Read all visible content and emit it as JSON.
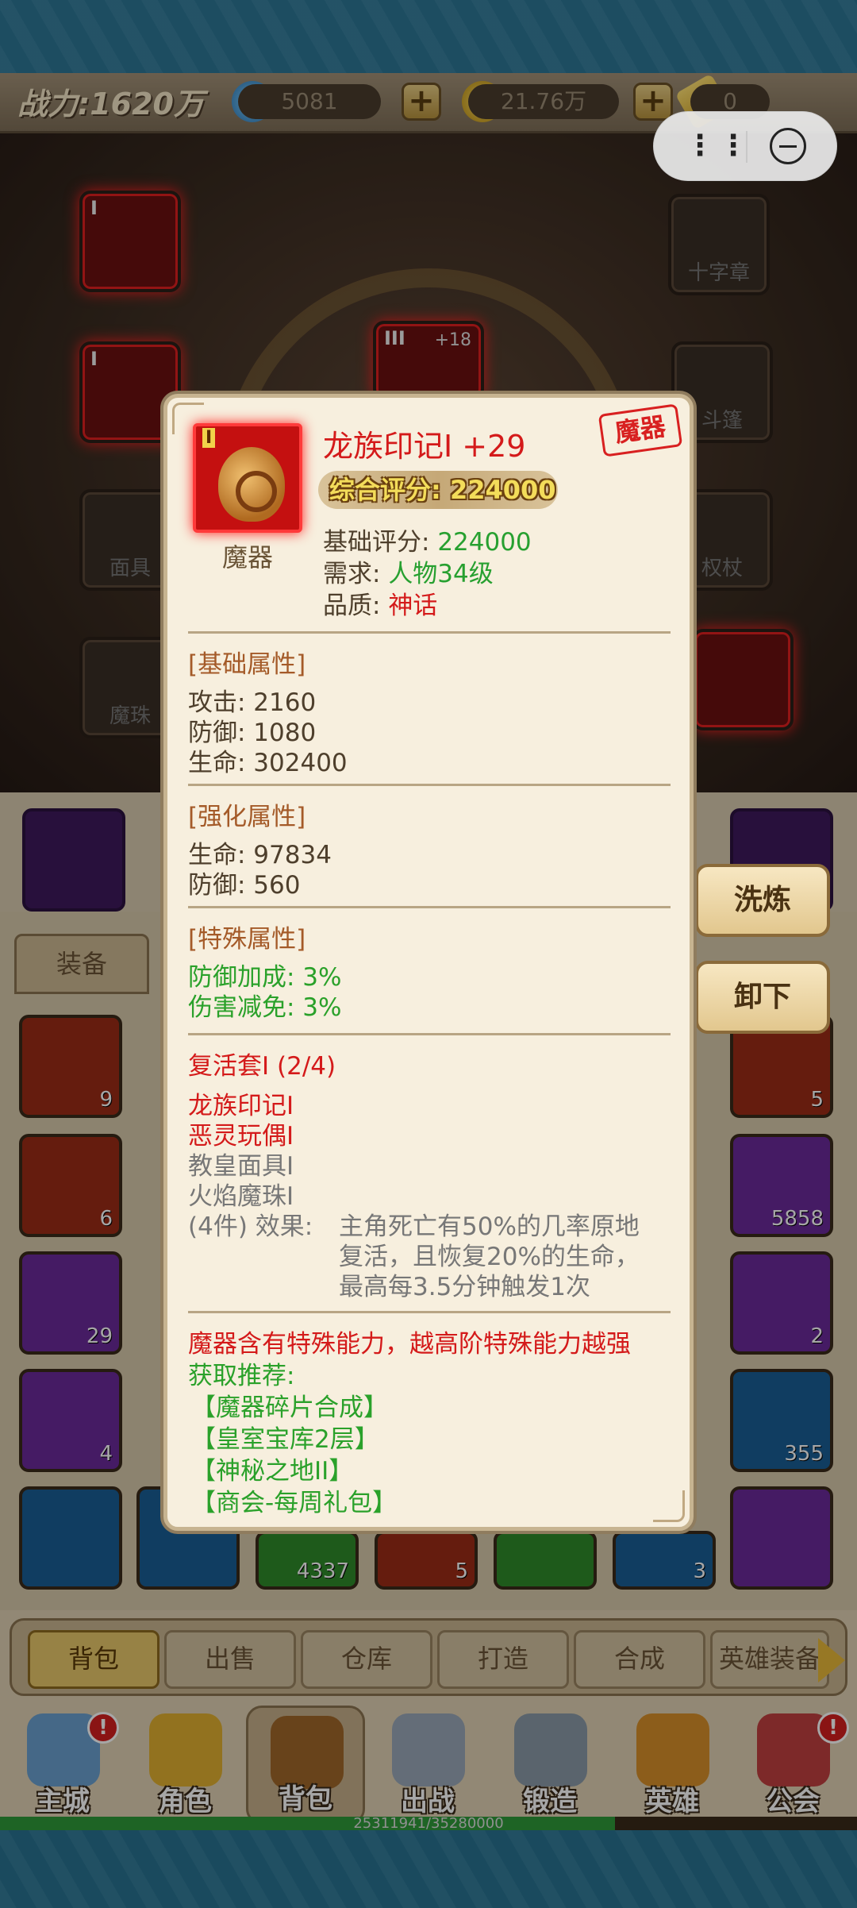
{
  "topbar": {
    "power_label": "战力:1620万",
    "gems": "5081",
    "gold": "21.76万",
    "tickets": "0"
  },
  "equip_slots": {
    "cross": "十字章",
    "cloak": "斗篷",
    "mask": "面具",
    "staff": "权杖",
    "orb": "魔珠",
    "enhance_level": "+18"
  },
  "inventory": {
    "tab_equip": "装备",
    "counts": [
      "9",
      "5",
      "6",
      "5858",
      "29",
      "2",
      "4",
      "355",
      "4337",
      "5",
      "3",
      "3"
    ]
  },
  "side_buttons": {
    "refine": "洗炼",
    "unequip": "卸下"
  },
  "sub_tabs": [
    "背包",
    "出售",
    "仓库",
    "打造",
    "合成",
    "英雄装备"
  ],
  "nav": [
    "主城",
    "角色",
    "背包",
    "出战",
    "锻造",
    "英雄",
    "公会"
  ],
  "xp": {
    "text": "25311941/35280000",
    "fraction": 0.7174
  },
  "popup": {
    "rank": "I",
    "category": "魔器",
    "stamp": "魔器",
    "title": "龙族印记I +29",
    "overall_score": "综合评分: 224000",
    "base_score_label": "基础评分:",
    "base_score_value": "224000",
    "require_label": "需求:",
    "require_value": "人物34级",
    "quality_label": "品质:",
    "quality_value": "神话",
    "base_attr_title": "[基础属性]",
    "base_attrs": [
      "攻击: 2160",
      "防御: 1080",
      "生命: 302400"
    ],
    "enh_attr_title": "[强化属性]",
    "enh_attrs": [
      "生命: 97834",
      "防御: 560"
    ],
    "special_title": "[特殊属性]",
    "special_attrs": [
      "防御加成: 3%",
      "伤害减免: 3%"
    ],
    "set_title": "复活套I (2/4)",
    "set_items_owned": [
      "龙族印记I",
      "恶灵玩偶I"
    ],
    "set_items_missing": [
      "教皇面具I",
      "火焰魔珠I"
    ],
    "set_effect_label": "(4件) 效果:",
    "set_effect_lines": [
      "主角死亡有50%的几率原地",
      "复活，且恢复20%的生命，",
      "最高每3.5分钟触发1次"
    ],
    "desc": "魔器含有特殊能力，越高阶特殊能力越强",
    "source_label": "获取推荐:",
    "sources": [
      "【魔器碎片合成】",
      "【皇室宝库2层】",
      "【神秘之地II】",
      "【商会-每周礼包】"
    ]
  },
  "colors": {
    "mythic_red": "#d41a1a",
    "green_value": "#27a030",
    "section_brown": "#a45a28",
    "popup_bg": "#f7efde"
  }
}
